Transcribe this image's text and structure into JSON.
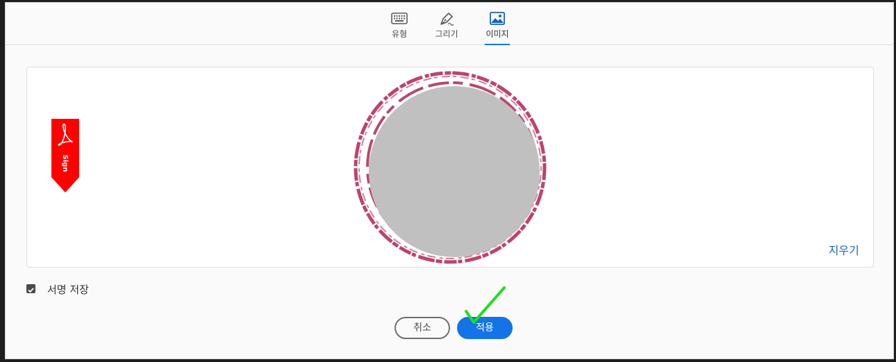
{
  "tabs": [
    {
      "label": "유형",
      "icon": "keyboard-icon",
      "active": false
    },
    {
      "label": "그리기",
      "icon": "pen-icon",
      "active": false
    },
    {
      "label": "이미지",
      "icon": "image-icon",
      "active": true
    }
  ],
  "canvas": {
    "badge_text": "Sign",
    "badge_icon": "adobe-acrobat-icon",
    "clear_label": "지우기"
  },
  "save_signature": {
    "label": "서명 저장",
    "checked": true
  },
  "buttons": {
    "cancel": "취소",
    "apply": "적용"
  },
  "colors": {
    "accent": "#1473e6",
    "stamp": "#b5305f",
    "badge": "#ff0000",
    "annotation_check": "#22dd22",
    "placeholder": "#c0c0c0"
  }
}
